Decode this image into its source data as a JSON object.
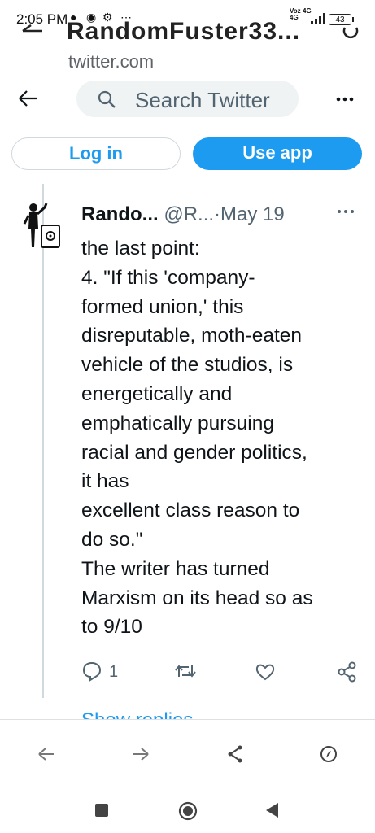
{
  "status_bar": {
    "time": "2:05 PM",
    "network_top": "Vo⃉ 4G",
    "network_label_a": "Voz",
    "network_label_b": "4G",
    "network_label_c": "4G",
    "battery": "43"
  },
  "browser": {
    "page_title": "RandomFuster33...",
    "url": "twitter.com"
  },
  "twitter": {
    "search_placeholder": "Search Twitter",
    "login_label": "Log in",
    "use_app_label": "Use app"
  },
  "tweet": {
    "name": "Rando...",
    "handle": "@R...",
    "separator": "·",
    "date": "May 19",
    "lines": [
      "the last point:",
      "4. \"If this 'company-",
      "formed union,' this",
      "disreputable, moth-eaten",
      "vehicle of  the studios, is",
      "energetically and",
      "emphatically pursuing",
      "racial and  gender politics,",
      "it has",
      "excellent class reason to",
      "do so.\"",
      "The writer has turned",
      "Marxism on its head so as",
      "to 9/10"
    ],
    "reply_count": "1",
    "show_replies": "Show replies"
  },
  "colors": {
    "accent": "#1d9bf0",
    "secondary_text": "#536471",
    "border": "#cfd9de"
  },
  "icons": [
    "back-arrow-icon",
    "reload-icon",
    "search-icon",
    "more-icon",
    "reply-icon",
    "retweet-icon",
    "like-icon",
    "share-icon",
    "nav-back-icon",
    "nav-forward-icon",
    "share-toolbar-icon",
    "compass-icon",
    "recents-icon",
    "home-icon",
    "system-back-icon"
  ]
}
